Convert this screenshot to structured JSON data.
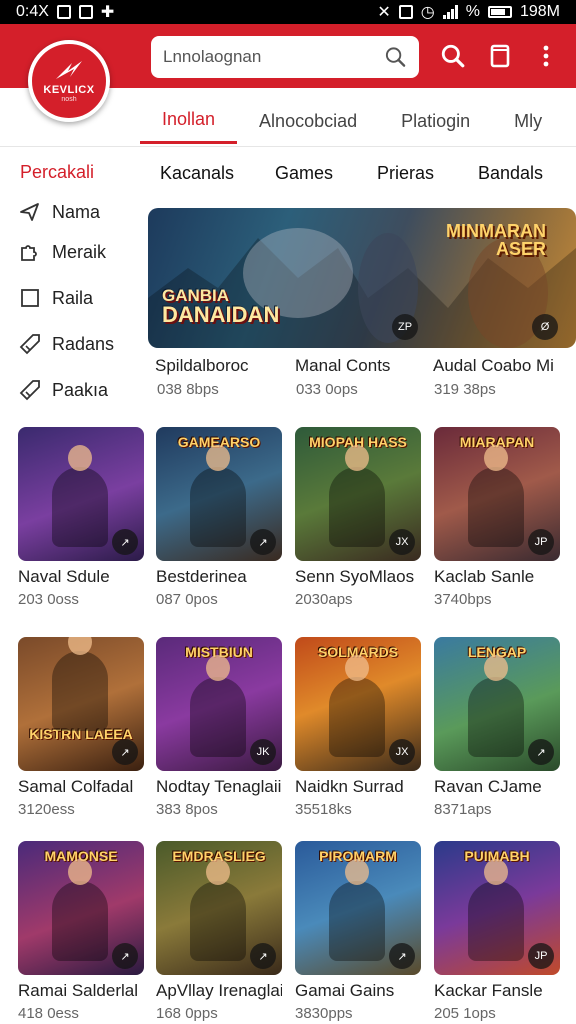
{
  "status_bar": {
    "time": "0:4X",
    "battery_text": "198M",
    "percent_text": "%"
  },
  "header": {
    "logo_text": "KEVLICX",
    "logo_sub": "nosh",
    "search_placeholder": "Lnnolaognan",
    "accent_color": "#d41f2a"
  },
  "tabs": [
    {
      "label": "Inollan",
      "active": true
    },
    {
      "label": "Alnocobciad",
      "active": false
    },
    {
      "label": "Platiogin",
      "active": false
    },
    {
      "label": "Mly",
      "active": false
    }
  ],
  "sidebar": {
    "title": "Percakali",
    "items": [
      {
        "label": "Nama",
        "icon": "send-icon"
      },
      {
        "label": "Meraik",
        "icon": "puzzle-icon"
      },
      {
        "label": "Raila",
        "icon": "square-icon"
      },
      {
        "label": "Radans",
        "icon": "tag-icon"
      },
      {
        "label": "Paakıa",
        "icon": "tag-icon"
      }
    ]
  },
  "categories": [
    "Kacanals",
    "Games",
    "Prieras",
    "Bandals"
  ],
  "banner": {
    "title_line1": "GANBIA",
    "title_line2": "DANAIDAN",
    "title_right1": "MINMARAN",
    "title_right2": "ASER",
    "badge_left": "ZP",
    "badge_right": "Ø"
  },
  "featured": [
    {
      "title": "Spildalboroc",
      "sub": "038 8bps"
    },
    {
      "title": "Manal Conts",
      "sub": "033 0ops"
    },
    {
      "title": "Audal Coabo Mi",
      "sub": "319 38ps"
    }
  ],
  "games": [
    {
      "title": "Naval Sdule",
      "sub": "203 0oss",
      "cover": "",
      "badge": "↗"
    },
    {
      "title": "Bestderinea",
      "sub": "087 0pos",
      "cover": "GAMEARSO",
      "badge": "↗"
    },
    {
      "title": "Senn SyoMlaos",
      "sub": "2030aps",
      "cover": "MIOPAH HASS",
      "badge": "JX"
    },
    {
      "title": "Kaclab Sanle",
      "sub": "3740bps",
      "cover": "MIARAPAN",
      "badge": "JP"
    },
    {
      "title": "Samal Colfadal",
      "sub": "3120ess",
      "cover": "KISTRN LAEEA",
      "badge": "↗"
    },
    {
      "title": "Nodtay Tenaglaii",
      "sub": "383 8pos",
      "cover": "MISTBIUN",
      "badge": "JK"
    },
    {
      "title": "Naidkn Surrad",
      "sub": "35518ks",
      "cover": "SOLMARDS",
      "badge": "JX"
    },
    {
      "title": "Ravan CJame",
      "sub": "8371aps",
      "cover": "LENGAP",
      "badge": "↗"
    },
    {
      "title": "Ramai Salderlal",
      "sub": "418 0ess",
      "cover": "MAMONSE",
      "badge": "↗"
    },
    {
      "title": "ApVllay Irenaglai",
      "sub": "168 0pps",
      "cover": "EMDRASLIEG",
      "badge": "↗"
    },
    {
      "title": "Gamai Gains",
      "sub": "3830pps",
      "cover": "PIROMARM",
      "badge": "↗"
    },
    {
      "title": "Kackar Fansle",
      "sub": "205 1ops",
      "cover": "PUIMABH",
      "badge": "JP"
    }
  ]
}
